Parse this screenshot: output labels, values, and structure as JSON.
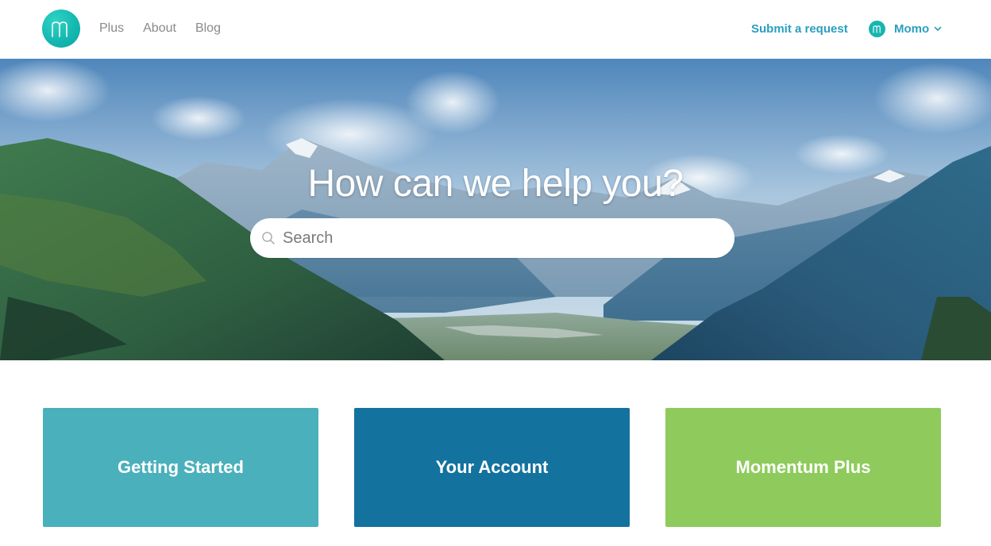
{
  "header": {
    "logo_icon": "momentum-logo-icon",
    "nav": [
      {
        "label": "Plus"
      },
      {
        "label": "About"
      },
      {
        "label": "Blog"
      }
    ],
    "submit_request": "Submit a request",
    "user": {
      "name": "Momo",
      "avatar_icon": "momentum-avatar-icon",
      "menu_icon": "chevron-down-icon"
    },
    "accent_color": "#2a9fbf",
    "brand_color": "#17b5b0"
  },
  "hero": {
    "title": "How can we help you?",
    "search": {
      "placeholder": "Search",
      "value": "",
      "icon": "search-icon"
    }
  },
  "blocks": [
    {
      "label": "Getting Started",
      "color": "#4ab0bb"
    },
    {
      "label": "Your Account",
      "color": "#14729f"
    },
    {
      "label": "Momentum Plus",
      "color": "#8ecb5c"
    }
  ]
}
